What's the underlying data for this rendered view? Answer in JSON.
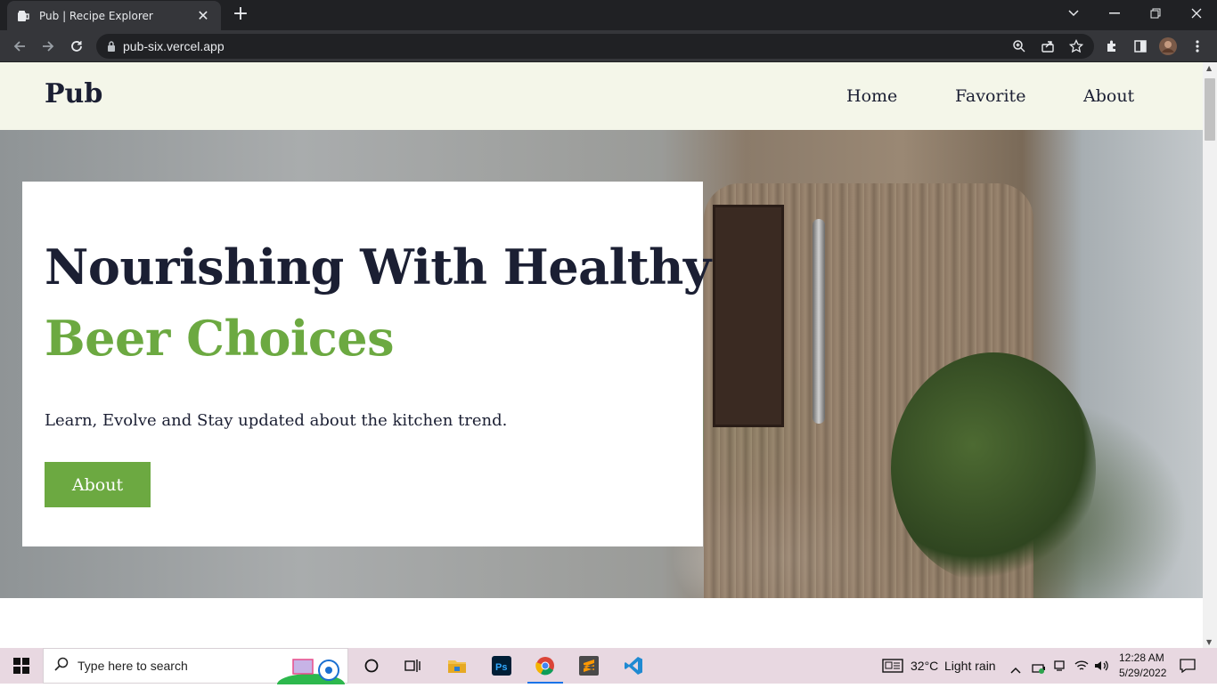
{
  "browser": {
    "tab_title": "Pub | Recipe Explorer",
    "tab_close": "✕",
    "new_tab": "+",
    "url": "pub-six.vercel.app"
  },
  "site": {
    "brand": "Pub",
    "nav": [
      "Home",
      "Favorite",
      "About"
    ],
    "hero": {
      "title_line1": "Nourishing With Healthy",
      "title_line2": "Beer Choices",
      "subtitle": "Learn, Evolve and Stay updated about the kitchen trend.",
      "button": "About"
    },
    "colors": {
      "accent": "#6ca941",
      "text": "#1b1f33",
      "header_bg": "#f4f6e9"
    }
  },
  "taskbar": {
    "search_placeholder": "Type here to search",
    "weather_temp": "32°C",
    "weather_desc": "Light rain",
    "time": "12:28 AM",
    "date": "5/29/2022"
  }
}
